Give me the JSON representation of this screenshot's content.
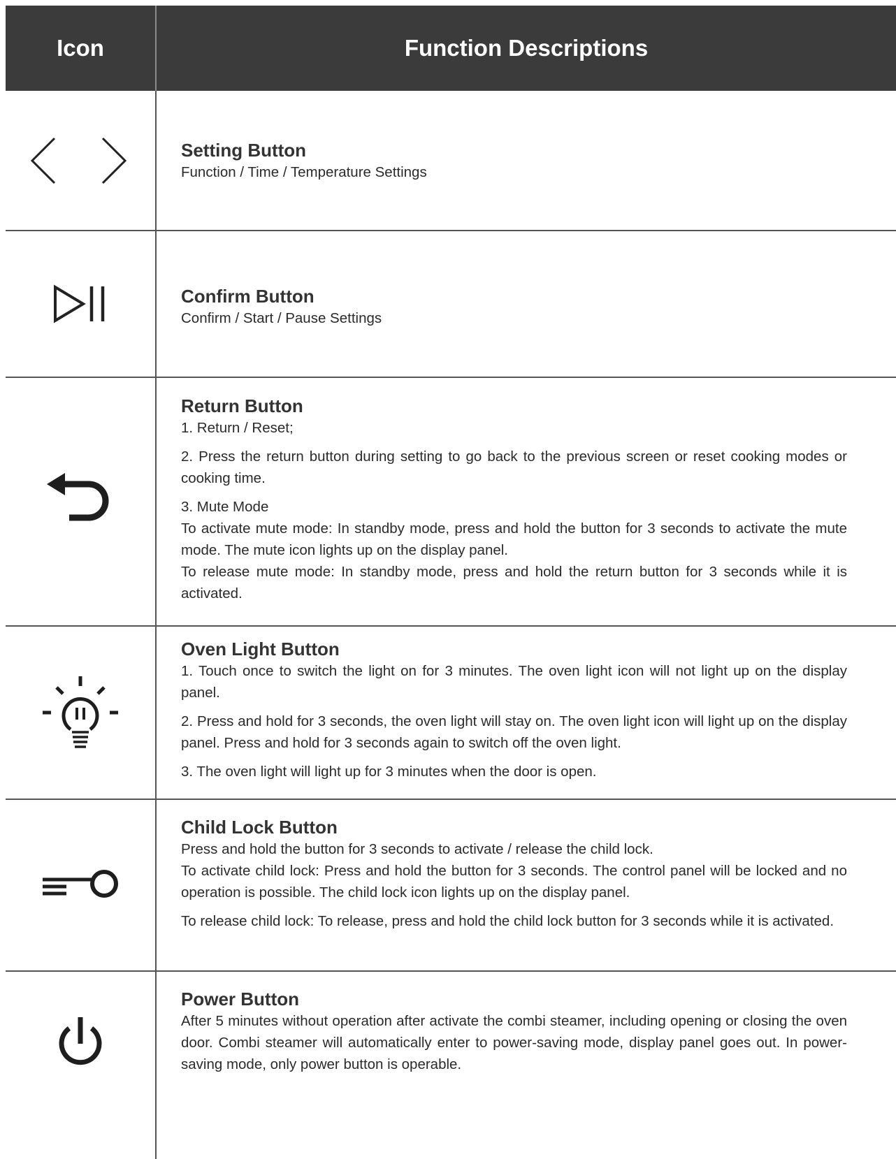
{
  "header": {
    "icon_col": "Icon",
    "desc_col": "Function Descriptions"
  },
  "rows": [
    {
      "icon": "left-right-chevrons-icon",
      "title": "Setting Button",
      "lines": [
        "Function / Time / Temperature Settings"
      ]
    },
    {
      "icon": "play-pause-icon",
      "title": "Confirm Button",
      "lines": [
        "Confirm / Start / Pause Settings"
      ]
    },
    {
      "icon": "return-arrow-icon",
      "title": "Return Button",
      "lines": [
        "1. Return / Reset;",
        "2. Press the return button during setting to go back to the previous screen or reset cooking modes or cooking time.",
        "3. Mute Mode",
        "To activate mute mode: In standby mode, press and hold the button for 3 seconds to activate the mute mode. The mute icon lights up on the display panel.",
        "To release mute mode: In standby mode, press and hold the return button for 3 seconds while it is activated."
      ]
    },
    {
      "icon": "light-bulb-icon",
      "title": "Oven Light Button",
      "lines": [
        "1. Touch once to switch the light on for 3 minutes. The oven light icon will not light up on the display panel.",
        "2. Press and hold for 3 seconds, the oven light will stay on. The oven light icon will light up on the display panel. Press and hold for 3 seconds again to switch off the oven light.",
        "3. The oven light will light up for 3 minutes when the door is open."
      ]
    },
    {
      "icon": "key-lock-icon",
      "title": "Child Lock Button",
      "lines": [
        "Press and hold the button for 3 seconds to activate / release the child lock.",
        "To activate child lock: Press and hold the button for 3 seconds. The control panel will be locked and no operation is possible. The child lock icon lights up on the display panel.",
        "To release child lock: To release, press and hold the child lock button for 3 seconds while it is activated."
      ]
    },
    {
      "icon": "power-icon",
      "title": "Power Button",
      "lines": [
        "After 5 minutes without operation after activate the combi steamer, including opening or closing the oven door. Combi steamer will automatically enter to power-saving mode, display panel goes out. In power-saving mode, only power button is operable."
      ]
    }
  ]
}
